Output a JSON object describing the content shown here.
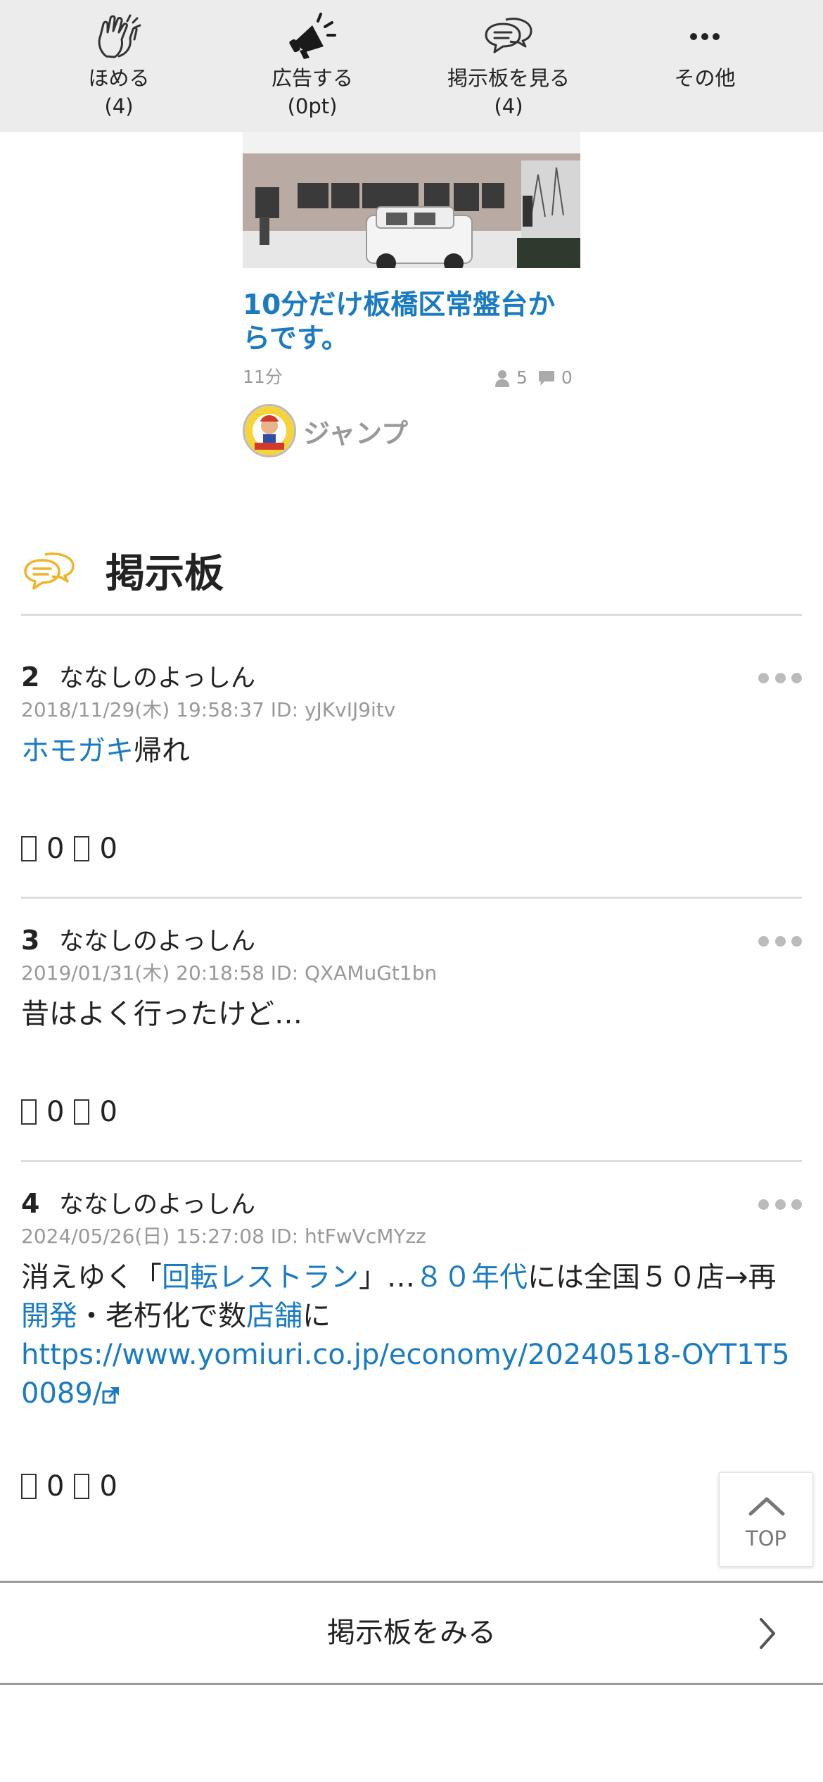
{
  "toolbar": {
    "items": [
      {
        "icon": "clap-hands-icon",
        "label": "ほめる",
        "count": "(4)"
      },
      {
        "icon": "megaphone-icon",
        "label": "広告する",
        "count": "(0pt)"
      },
      {
        "icon": "speech-bubbles-icon",
        "label": "掲示板を見る",
        "count": "(4)"
      },
      {
        "icon": "more-dots-icon",
        "label": "その他",
        "count": ""
      }
    ]
  },
  "article_card": {
    "title": "10分だけ板橋区常盤台からです。",
    "time": "11分",
    "likes": "5",
    "comments": "0",
    "author": "ジャンプ"
  },
  "board": {
    "title": "掲示板",
    "icon": "speech-bubbles-icon",
    "posts": [
      {
        "num": "2",
        "name": "ななしのよっしん",
        "meta": "2018/11/29(木) 19:58:37 ID: yJKvIJ9itv",
        "body_link": "ホモガキ",
        "body_text": "帰れ",
        "up": "0",
        "down": "0"
      },
      {
        "num": "3",
        "name": "ななしのよっしん",
        "meta": "2019/01/31(木) 20:18:58 ID: QXAMuGt1bn",
        "body_text": "昔はよく行ったけど…",
        "up": "0",
        "down": "0"
      },
      {
        "num": "4",
        "name": "ななしのよっしん",
        "meta": "2024/05/26(日) 15:27:08 ID: htFwVcMYzz",
        "body_parts": {
          "t1": "消えゆく「",
          "l1": "回転レストラン",
          "t2": "」…",
          "l2": "８０年代",
          "t3": "には全国５０店→再",
          "l3": "開発",
          "t4": "・老朽化で数",
          "l4": "店舗",
          "t5": "に",
          "url": "https://www.yomiuri.co.jp/economy/20240518-OYT1T50089/"
        },
        "up": "0",
        "down": "0"
      }
    ]
  },
  "top_button": {
    "label": "TOP"
  },
  "footer": {
    "more_label": "掲示板をみる"
  },
  "colors": {
    "link": "#1a7bc1",
    "toolbar_bg": "#ececec",
    "accent_icon": "#f0b429"
  }
}
